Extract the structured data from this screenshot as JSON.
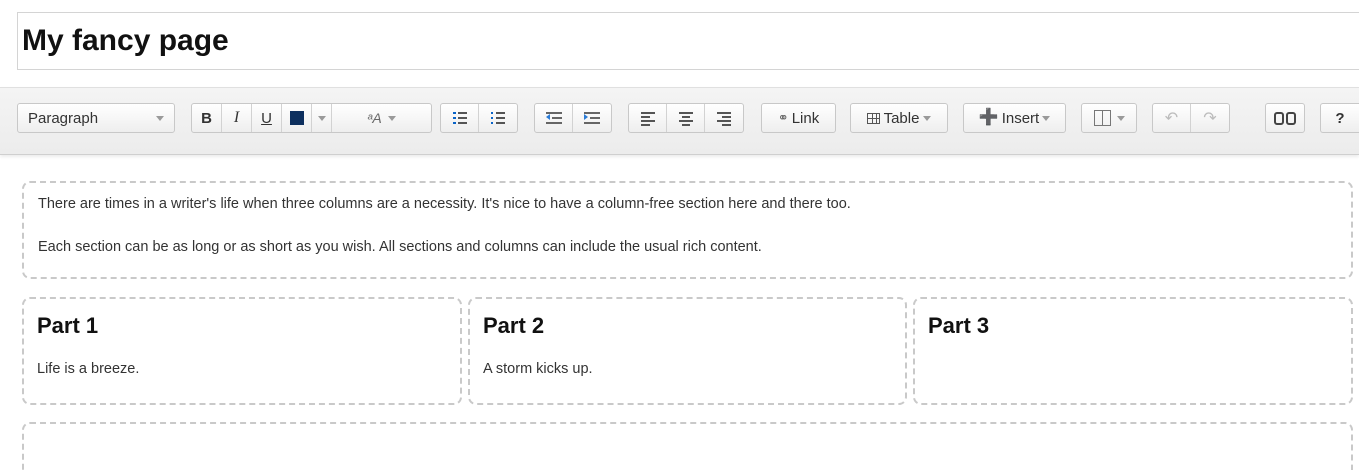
{
  "title": {
    "value": "My fancy page"
  },
  "toolbar": {
    "format_select": {
      "label": "Paragraph",
      "icon": "chevron-down-icon"
    },
    "bold": "B",
    "italic": "I",
    "underline": "U",
    "text_color": {
      "icon": "text-color-icon",
      "color": "#0d2f5e"
    },
    "font_size_icon": "ᵃA",
    "bullet_list": "bullet-list-icon",
    "numbered_list": "numbered-list-icon",
    "outdent": "outdent-icon",
    "indent": "indent-icon",
    "align_left": "align-left-icon",
    "align_center": "align-center-icon",
    "align_right": "align-right-icon",
    "link_label": "Link",
    "table_label": "Table",
    "insert_label": "Insert",
    "layout": "column-layout-icon",
    "undo": "undo-icon",
    "redo": "redo-icon",
    "find": "binoculars-icon",
    "help_label": "?"
  },
  "content": {
    "intro": {
      "paragraphs": [
        "There are times in a writer's life when three columns are a necessity. It's nice to have a column-free section here and there too.",
        "Each section can be as long or as short as you wish. All sections and columns can include the usual rich content."
      ]
    },
    "columns": [
      {
        "heading": "Part 1",
        "text": "Life is a breeze."
      },
      {
        "heading": "Part 2",
        "text": "A storm kicks up."
      },
      {
        "heading": "Part 3",
        "text": ""
      }
    ]
  }
}
